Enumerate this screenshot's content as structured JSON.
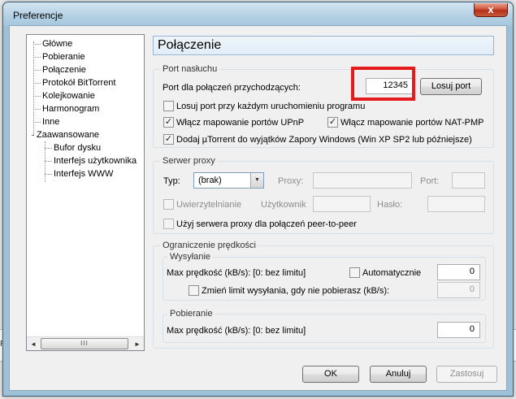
{
  "window": {
    "title": "Preferencje",
    "close_glyph": "x"
  },
  "background": {
    "left_fragment": "Pręd"
  },
  "tree": {
    "items": [
      {
        "label": "Główne"
      },
      {
        "label": "Pobieranie"
      },
      {
        "label": "Połączenie"
      },
      {
        "label": "Protokół BitTorrent"
      },
      {
        "label": "Kolejkowanie"
      },
      {
        "label": "Harmonogram"
      },
      {
        "label": "Inne"
      },
      {
        "label": "Zaawansowane"
      },
      {
        "label": "Bufor dysku"
      },
      {
        "label": "Interfejs użytkownika"
      },
      {
        "label": "Interfejs WWW"
      }
    ],
    "expander_glyph": "-",
    "scroll_left": "◄",
    "scroll_right": "►",
    "scroll_grip": "III"
  },
  "page": {
    "title": "Połączenie"
  },
  "listen_port": {
    "group_title": "Port nasłuchu",
    "port_label": "Port dla połączeń przychodzących:",
    "port_value": "12345",
    "random_button": "Losuj port",
    "random_each_start": {
      "label": "Losuj port przy każdym uruchomieniu programu",
      "checked": false
    },
    "upnp": {
      "label": "Włącz mapowanie portów UPnP",
      "checked": true
    },
    "natpmp": {
      "label": "Włącz mapowanie portów NAT-PMP",
      "checked": true
    },
    "firewall": {
      "label": "Dodaj µTorrent do wyjątków Zapory Windows (Win XP SP2 lub późniejsze)",
      "checked": true
    }
  },
  "proxy": {
    "group_title": "Serwer proxy",
    "type_label": "Typ:",
    "type_value": "(brak)",
    "proxy_label": "Proxy:",
    "proxy_value": "",
    "port_label": "Port:",
    "port_value": "",
    "auth": {
      "label": "Uwierzytelnianie",
      "checked": false
    },
    "user_label": "Użytkownik",
    "user_value": "",
    "password_label": "Hasło:",
    "password_value": "",
    "p2p": {
      "label": "Użyj serwera proxy dla połączeń peer-to-peer",
      "checked": false
    }
  },
  "speed_limit": {
    "group_title": "Ograniczenie prędkości",
    "upload": {
      "title": "Wysyłanie",
      "max_label": "Max prędkość (kB/s): [0: bez limitu]",
      "auto": {
        "label": "Automatycznie",
        "checked": false
      },
      "max_value": "0",
      "alt": {
        "label": "Zmień limit wysyłania, gdy nie pobierasz (kB/s):",
        "checked": false
      },
      "alt_value": "0"
    },
    "download": {
      "title": "Pobieranie",
      "max_label": "Max prędkość (kB/s): [0: bez limitu]",
      "max_value": "0"
    }
  },
  "buttons": {
    "ok": "OK",
    "cancel": "Anuluj",
    "apply": "Zastosuj"
  },
  "colors": {
    "highlight": "#e31b1b",
    "header_bg": "#e6f0f9"
  }
}
